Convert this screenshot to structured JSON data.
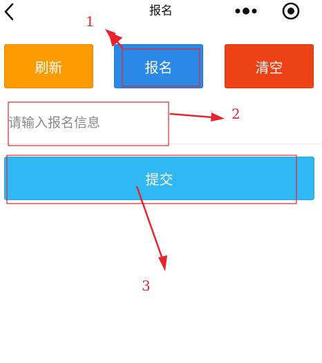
{
  "navbar": {
    "title": "报名",
    "back_icon": "chevron-left-icon",
    "more_icon": "more-dots-icon",
    "close_icon": "capsule-close-icon"
  },
  "actions": {
    "refresh_label": "刷新",
    "signup_label": "报名",
    "clear_label": "清空"
  },
  "form": {
    "input_placeholder": "请输入报名信息",
    "input_value": "",
    "submit_label": "提交"
  },
  "annotations": {
    "label_1": "1",
    "label_2": "2",
    "label_3": "3",
    "color": "#e8232c"
  },
  "colors": {
    "refresh_bg": "#fc9a02",
    "signup_bg": "#2a88e6",
    "clear_bg": "#ef4116",
    "submit_bg": "#2fb8f4"
  }
}
